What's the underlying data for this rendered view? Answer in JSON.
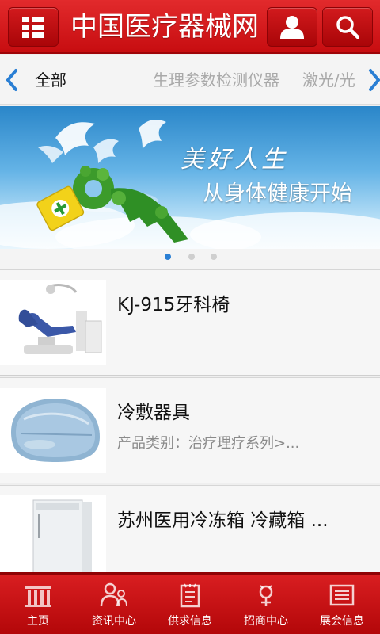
{
  "header": {
    "title": "中国医疗器械网",
    "menu_icon": "grid-menu-icon",
    "user_icon": "user-icon",
    "search_icon": "search-icon"
  },
  "categories": {
    "tabs": [
      "全部",
      "生理参数检测仪器",
      "激光/光"
    ],
    "active_index": 0
  },
  "banner": {
    "tagline": "美好人生",
    "subtitle": "从身体健康开始",
    "slide_count": 3,
    "active_slide": 0
  },
  "products": [
    {
      "name": "KJ-915牙科椅",
      "meta": ""
    },
    {
      "name": "冷敷器具",
      "meta": "产品类别：治疗理疗系列>..."
    },
    {
      "name": "苏州医用冷冻箱 冷藏箱 ...",
      "meta": ""
    }
  ],
  "bottom_nav": [
    {
      "label": "主页",
      "icon": "home-icon"
    },
    {
      "label": "资讯中心",
      "icon": "news-icon"
    },
    {
      "label": "供求信息",
      "icon": "supply-icon"
    },
    {
      "label": "招商中心",
      "icon": "business-icon"
    },
    {
      "label": "展会信息",
      "icon": "exhibition-icon"
    }
  ],
  "colors": {
    "brand_red": "#d0121a",
    "active_dot": "#2a7fd4"
  }
}
